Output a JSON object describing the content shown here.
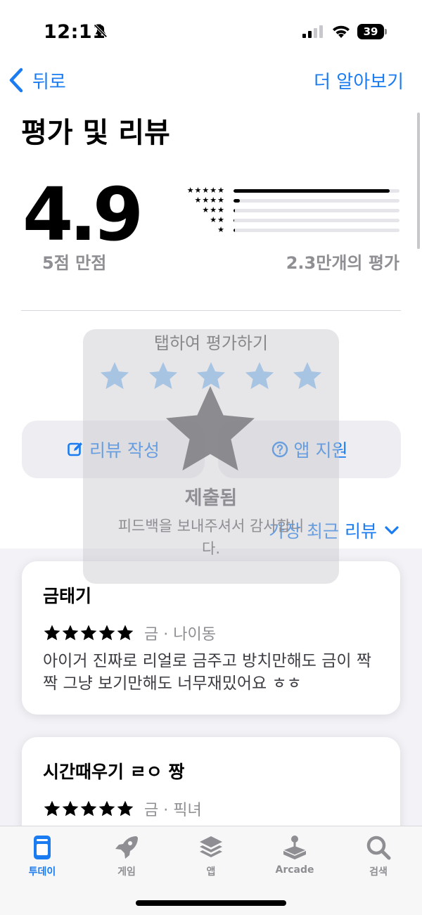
{
  "status_bar": {
    "time": "12:11",
    "battery": "39"
  },
  "nav": {
    "back_label": "뒤로",
    "learn_more_label": "더 알아보기"
  },
  "ratings": {
    "title": "평가 및 리뷰",
    "average": "4.9",
    "out_of": "5점 만점",
    "count": "2.3만개의 평가",
    "distribution": [
      {
        "stars": "★★★★★",
        "fraction": 0.94
      },
      {
        "stars": "★★★★",
        "fraction": 0.04
      },
      {
        "stars": "★★★",
        "fraction": 0.01
      },
      {
        "stars": "★★",
        "fraction": 0.005
      },
      {
        "stars": "★",
        "fraction": 0.01
      }
    ]
  },
  "tap_to_rate": {
    "label": "탭하여 평가하기",
    "selected": 5
  },
  "actions": {
    "write_review": "리뷰 작성",
    "app_support": "앱 지원"
  },
  "sort": {
    "label": "가장 최근 리뷰"
  },
  "overlay": {
    "submitted": "제출됨",
    "thanks": "피드백을 보내주셔서 감사합니다."
  },
  "reviews": [
    {
      "title": "금태기",
      "meta": "금 · 나이동",
      "body": "아이거 진짜로 리얼로 금주고 방치만해도 금이 짝짝 그냥 보기만해도 너무재밌어요 ㅎㅎ",
      "rating": 5
    },
    {
      "title": "시간때우기 ㄹㅇ 짱",
      "meta": "금 · 픽녀",
      "rating": 5
    }
  ],
  "tabs": [
    {
      "label": "투데이",
      "icon": "today-icon",
      "active": true
    },
    {
      "label": "게임",
      "icon": "rocket-icon",
      "active": false
    },
    {
      "label": "앱",
      "icon": "layers-icon",
      "active": false
    },
    {
      "label": "Arcade",
      "icon": "arcade-icon",
      "active": false
    },
    {
      "label": "검색",
      "icon": "search-icon",
      "active": false
    }
  ],
  "colors": {
    "accent": "#1a7cf0",
    "light_star": "#8ec2f6",
    "secondary_text": "#8e8e93"
  }
}
